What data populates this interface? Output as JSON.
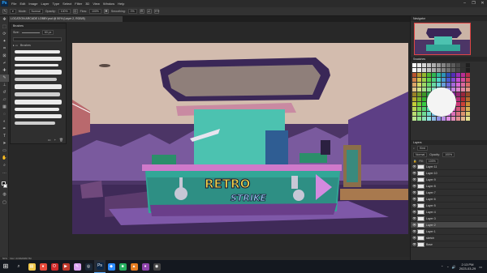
{
  "app": {
    "menu": [
      "File",
      "Edit",
      "Image",
      "Layer",
      "Type",
      "Select",
      "Filter",
      "3D",
      "View",
      "Window",
      "Help"
    ],
    "window_controls": [
      "–",
      "❐",
      "✕"
    ]
  },
  "options": {
    "mode_label": "Mode:",
    "mode_value": "Normal",
    "opacity_label": "Opacity:",
    "opacity_value": "100%",
    "flow_label": "Flow:",
    "flow_value": "100%",
    "smoothing_label": "Smoothing:",
    "smoothing_value": "0%"
  },
  "document": {
    "tab_title": "LOCATION ARCADE LOBBY.psd @ 50% (Layer 2, RGB/8)"
  },
  "brushes_panel": {
    "title": "Brushes",
    "size_label": "Size:",
    "size_value": "60 px",
    "group_name": "Brushes"
  },
  "canvas": {
    "logo_line1": "RETRO",
    "logo_line2": "STRIKE"
  },
  "status": {
    "zoom": "50%",
    "doc": "Doc: 24.9M/183.7M"
  },
  "right_panels": {
    "navigator_title": "Navigator",
    "swatches_title": "Swatches",
    "layers_title": "Layers",
    "kind_label": "Kind",
    "blend_value": "Normal",
    "opacity_label": "Opacity:",
    "fill_label": "Fill:",
    "layers": [
      "Layer 11",
      "Layer 10",
      "Layer 9",
      "Layer 8",
      "Layer 7",
      "Layer 6",
      "Layer 5",
      "Layer 4",
      "Layer 3",
      "Layer 2",
      "Layer 1",
      "sketch",
      "Base"
    ],
    "selected_layer_index": 9
  },
  "taskbar": {
    "apps": [
      {
        "name": "file-explorer",
        "glyph": "▤",
        "color": "#f2c94c"
      },
      {
        "name": "chrome",
        "glyph": "●",
        "color": "#e84b3c"
      },
      {
        "name": "opera",
        "glyph": "O",
        "color": "#d12b2b"
      },
      {
        "name": "app-red",
        "glyph": "▶",
        "color": "#c0392b"
      },
      {
        "name": "clip-studio",
        "glyph": "✎",
        "color": "#d9a3f0"
      },
      {
        "name": "steam",
        "glyph": "◎",
        "color": "#1b2838"
      },
      {
        "name": "photoshop",
        "glyph": "Ps",
        "color": "#0c2747"
      },
      {
        "name": "app-blue",
        "glyph": "◆",
        "color": "#2d8cff"
      },
      {
        "name": "app-green",
        "glyph": "■",
        "color": "#27ae60"
      },
      {
        "name": "app-orange",
        "glyph": "▲",
        "color": "#e67e22"
      },
      {
        "name": "app-purple",
        "glyph": "♦",
        "color": "#8e44ad"
      },
      {
        "name": "obs",
        "glyph": "◉",
        "color": "#444"
      }
    ],
    "time": "2:13 PM",
    "date": "2023-03-29"
  }
}
